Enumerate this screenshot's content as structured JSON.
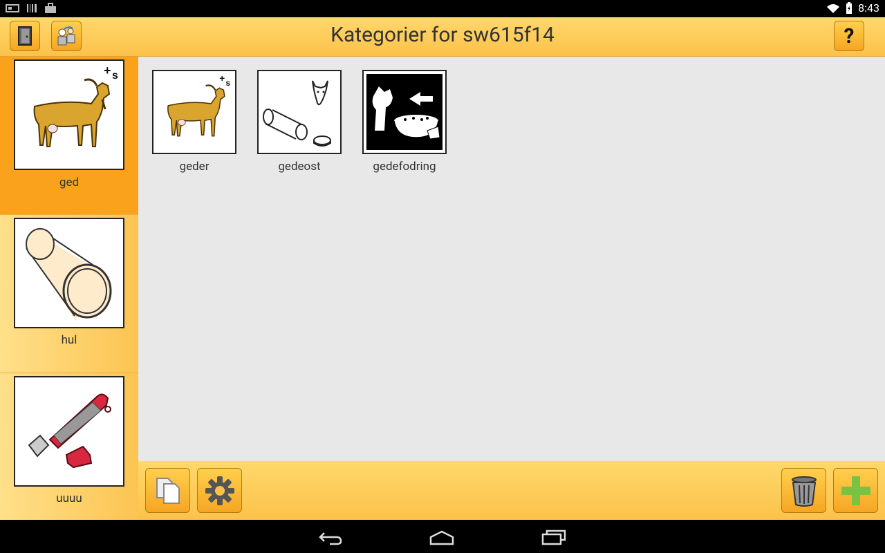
{
  "status_bar": {
    "time": "8:43",
    "icons": [
      "photo-icon",
      "barcode-icon",
      "bag-icon",
      "wifi-icon",
      "battery-icon"
    ]
  },
  "header": {
    "title": "Kategorier for sw615f14",
    "left_buttons": [
      "exit-door-icon",
      "switch-profile-icon"
    ],
    "help_label": "?"
  },
  "sidebar": {
    "items": [
      {
        "label": "ged",
        "icon": "goat-icon",
        "selected": true
      },
      {
        "label": "hul",
        "icon": "pipe-icon",
        "selected": false
      },
      {
        "label": "uuuu",
        "icon": "usb-stick-icon",
        "selected": false
      }
    ]
  },
  "main": {
    "tiles": [
      {
        "label": "geder",
        "icon": "goat-plural-icon"
      },
      {
        "label": "gedeost",
        "icon": "goat-cheese-icon"
      },
      {
        "label": "gedefodring",
        "icon": "goat-feeding-icon"
      }
    ]
  },
  "bottom_bar": {
    "left": [
      "copy-icon",
      "settings-gear-icon"
    ],
    "right": [
      "trash-icon",
      "add-plus-icon"
    ]
  },
  "nav_bar": [
    "back-icon",
    "home-icon",
    "recents-icon"
  ],
  "colors": {
    "accent": "#f5a623",
    "selected": "#fba21c",
    "header": "#fbc24a",
    "main_bg": "#e8e8e8",
    "plus_green": "#7cc242"
  }
}
